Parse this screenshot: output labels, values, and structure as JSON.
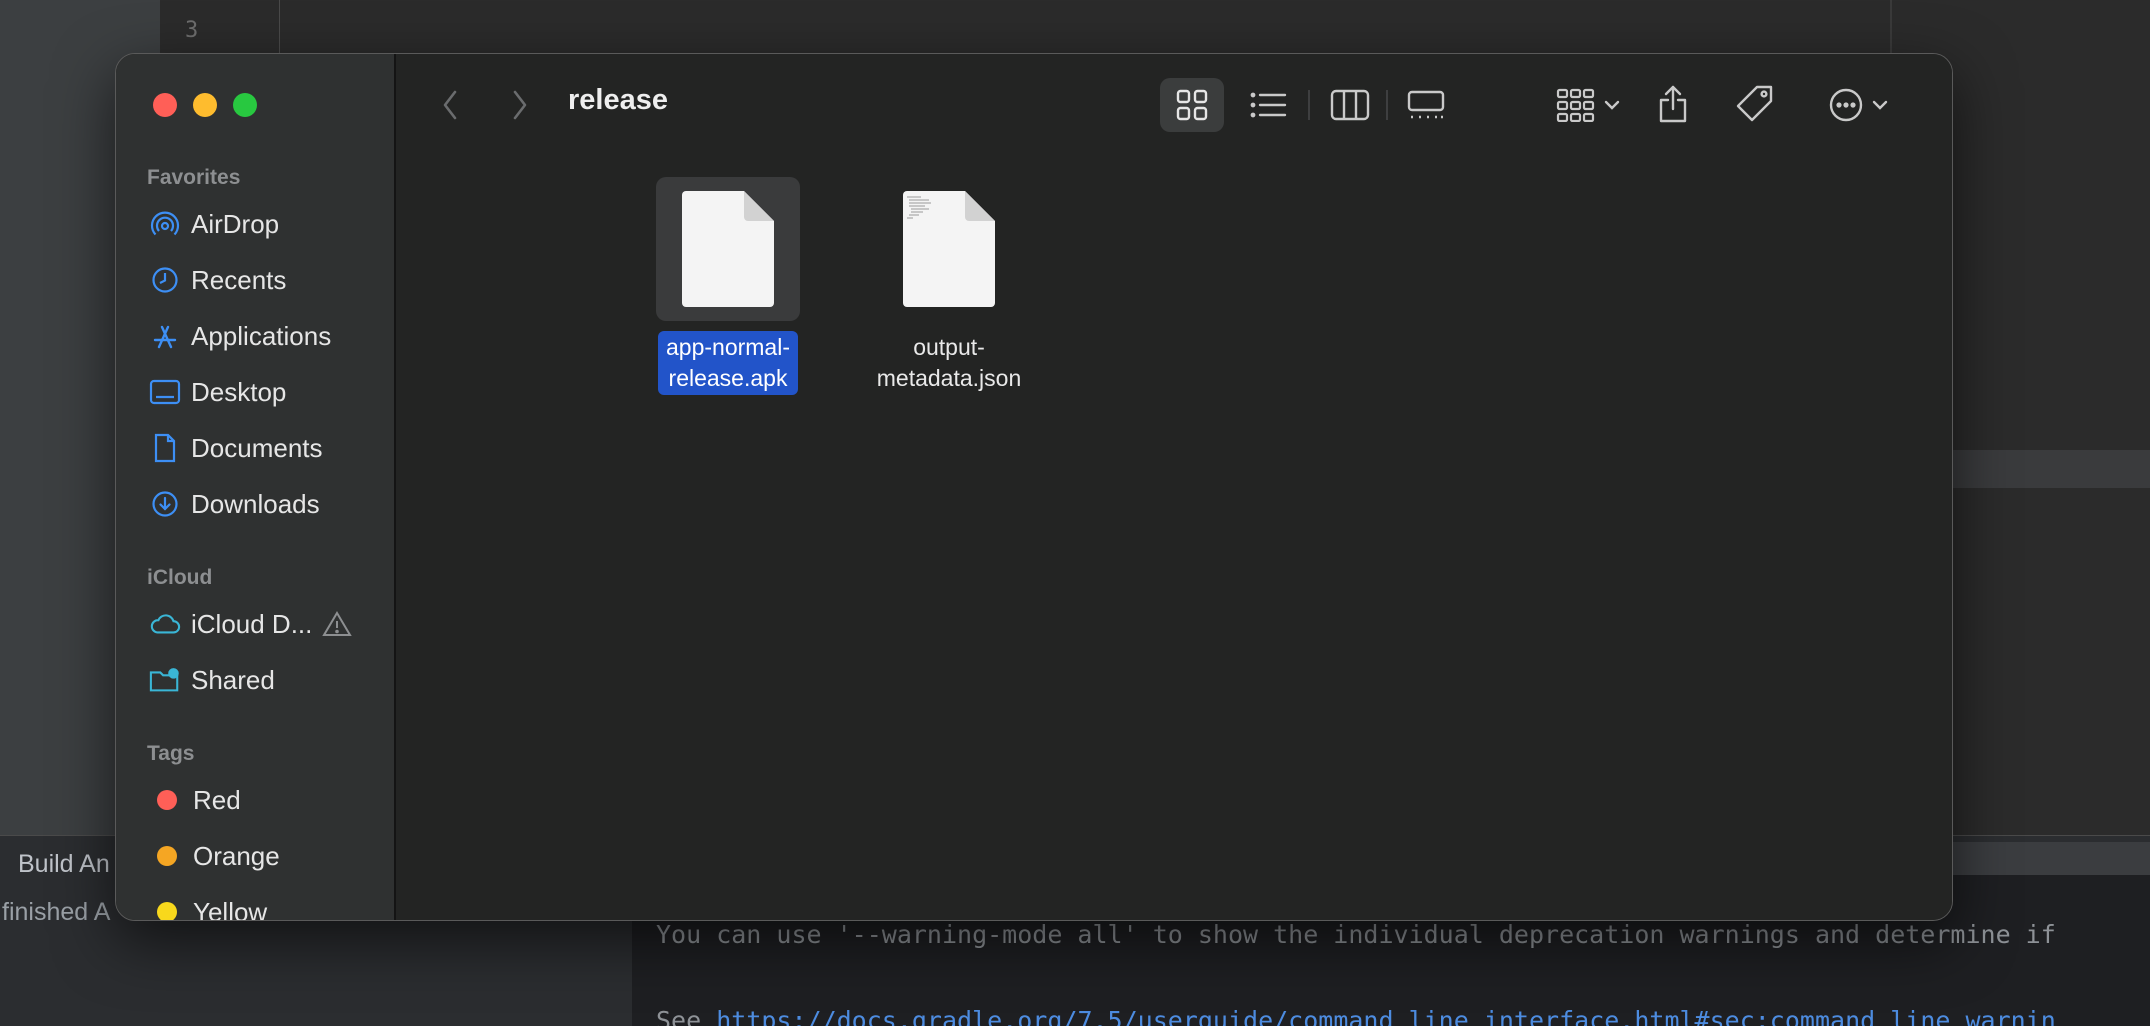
{
  "ide": {
    "line_number": "3",
    "build_tab": "Build An",
    "status": "finished A",
    "console_line1": "You can use '--warning-mode all' to show the individual deprecation warnings and determine if",
    "console_line2_prefix": "See ",
    "console_line2_link": "https://docs.gradle.org/7.5/userguide/command_line_interface.html#sec:command_line_warnin"
  },
  "finder": {
    "title": "release",
    "sidebar": {
      "favorites_header": "Favorites",
      "favorites": [
        {
          "label": "AirDrop",
          "icon": "airdrop-icon"
        },
        {
          "label": "Recents",
          "icon": "clock-icon"
        },
        {
          "label": "Applications",
          "icon": "applications-icon"
        },
        {
          "label": "Desktop",
          "icon": "desktop-icon"
        },
        {
          "label": "Documents",
          "icon": "document-icon"
        },
        {
          "label": "Downloads",
          "icon": "download-icon"
        }
      ],
      "icloud_header": "iCloud",
      "icloud": [
        {
          "label": "iCloud D...",
          "icon": "cloud-icon"
        },
        {
          "label": "Shared",
          "icon": "shared-folder-icon"
        }
      ],
      "tags_header": "Tags",
      "tags": [
        {
          "label": "Red",
          "color": "#ff5f57"
        },
        {
          "label": "Orange",
          "color": "#f5a623"
        },
        {
          "label": "Yellow",
          "color": "#f8d81c"
        }
      ]
    },
    "files": [
      {
        "line1": "app-normal-",
        "line2": "release.apk",
        "selected": true
      },
      {
        "line1": "output-",
        "line2": "metadata.json",
        "selected": false
      }
    ]
  }
}
